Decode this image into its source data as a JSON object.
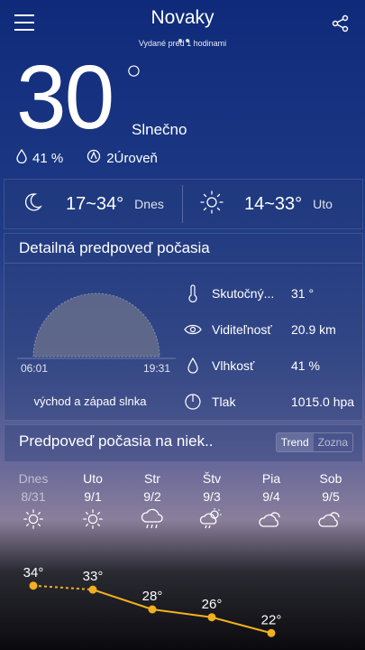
{
  "header": {
    "city": "Novaky",
    "updated": "Vydané pred 1 hodinami"
  },
  "current": {
    "temp": "30",
    "condition": "Slnečno",
    "humidity": "41 %",
    "level": "2Úroveň"
  },
  "today_range": {
    "range": "17~34°",
    "day": "Dnes"
  },
  "tomorrow_range": {
    "range": "14~33°",
    "day": "Uto"
  },
  "detail": {
    "title": "Detailná predpoveď počasia",
    "sunrise": "06:01",
    "sunset": "19:31",
    "sun_label": "východ a západ slnka",
    "rows": [
      {
        "label": "Skutočný...",
        "value": "31 °",
        "icon": "thermometer-icon"
      },
      {
        "label": "Viditeľnosť",
        "value": "20.9 km",
        "icon": "eye-icon"
      },
      {
        "label": "Vlhkosť",
        "value": "41 %",
        "icon": "drop-icon"
      },
      {
        "label": "Tlak",
        "value": "1015.0 hpa",
        "icon": "gauge-icon"
      }
    ]
  },
  "forecast": {
    "title": "Predpoveď počasia na niek..",
    "toggle_on": "Trend",
    "toggle_off": "Zozna",
    "days": [
      {
        "name": "Dnes",
        "date": "8/31",
        "icon": "sun-icon"
      },
      {
        "name": "Uto",
        "date": "9/1",
        "icon": "sun-icon"
      },
      {
        "name": "Str",
        "date": "9/2",
        "icon": "rain-cloud-icon"
      },
      {
        "name": "Štv",
        "date": "9/3",
        "icon": "partly-cloudy-rain-icon"
      },
      {
        "name": "Pia",
        "date": "9/4",
        "icon": "partly-cloudy-icon"
      },
      {
        "name": "Sob",
        "date": "9/5",
        "icon": "partly-cloudy-icon"
      }
    ],
    "highs": [
      "34°",
      "33°",
      "28°",
      "26°",
      "22°"
    ]
  },
  "chart_data": {
    "type": "line",
    "x": [
      "Dnes",
      "Uto",
      "Str",
      "Štv",
      "Pia"
    ],
    "series": [
      {
        "values": [
          34,
          33,
          28,
          26,
          22
        ]
      }
    ]
  },
  "colors": {
    "trend_line": "#f2b01e"
  }
}
